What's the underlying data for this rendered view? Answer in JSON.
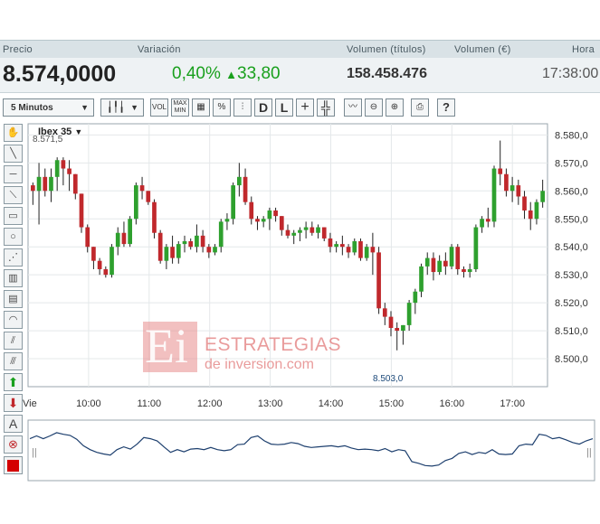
{
  "header": {
    "col_price": "Precio",
    "col_variation": "Variación",
    "col_volume_titles": "Volumen (títulos)",
    "col_volume_eur": "Volumen (€)",
    "col_time": "Hora"
  },
  "quote": {
    "price": "8.574,0000",
    "variation_pct": "0,40%",
    "variation_arrow": "▲",
    "variation_points": "33,80",
    "volume_titles": "158.458.476",
    "time": "17:38:00",
    "up_color": "#19a01d"
  },
  "toolbar": {
    "interval_select": "5 Minutos",
    "chart_type_icon": "candlestick-icon",
    "buttons": [
      "VOL",
      "MAX MIN",
      "grid",
      "%",
      "compare",
      "D",
      "L",
      "+",
      "crosshair",
      "indicator",
      "zoom-out",
      "zoom-in",
      "print",
      "?"
    ],
    "btn_vol": "VOL",
    "btn_maxmin_1": "MAX",
    "btn_maxmin_2": "MIN",
    "btn_pct": "%",
    "btn_d": "D",
    "btn_l": "L",
    "btn_help": "?"
  },
  "watermark": {
    "logo": "Ei",
    "line1": "ESTRATEGIAS",
    "line2": "de inversion.com"
  },
  "chart_data": {
    "type": "candlestick",
    "title": "Ibex 35",
    "title_arrow": "▼",
    "max_label": "8.571,5",
    "min_label": "8.503,0",
    "ylim": [
      8490,
      8584
    ],
    "y_ticks": [
      "8.580,0",
      "8.570,0",
      "8.560,0",
      "8.550,0",
      "8.540,0",
      "8.530,0",
      "8.520,0",
      "8.510,0",
      "8.500,0"
    ],
    "y_tick_values": [
      8580,
      8570,
      8560,
      8550,
      8540,
      8530,
      8520,
      8510,
      8500
    ],
    "x_ticks": [
      "Vie",
      "10:00",
      "11:00",
      "12:00",
      "13:00",
      "14:00",
      "15:00",
      "16:00",
      "17:00"
    ],
    "x_tick_hours": [
      9.0,
      10.0,
      11.0,
      12.0,
      13.0,
      14.0,
      15.0,
      16.0,
      17.0
    ],
    "x_range_hours": [
      9.0,
      17.58
    ],
    "up_color": "#2ea02e",
    "down_color": "#c0282c",
    "grid": true,
    "candles": [
      [
        8562,
        8563,
        8555,
        8560
      ],
      [
        8560,
        8570,
        8548,
        8565
      ],
      [
        8565,
        8568,
        8558,
        8560
      ],
      [
        8560,
        8568,
        8556,
        8565
      ],
      [
        8565,
        8572,
        8560,
        8571
      ],
      [
        8571,
        8572,
        8562,
        8568
      ],
      [
        8568,
        8571,
        8560,
        8566
      ],
      [
        8566,
        8566,
        8557,
        8559
      ],
      [
        8559,
        8559,
        8545,
        8547
      ],
      [
        8547,
        8548,
        8538,
        8540
      ],
      [
        8540,
        8540,
        8532,
        8535
      ],
      [
        8535,
        8536,
        8530,
        8532
      ],
      [
        8532,
        8533,
        8529,
        8530
      ],
      [
        8530,
        8541,
        8529,
        8540
      ],
      [
        8540,
        8547,
        8537,
        8545
      ],
      [
        8545,
        8549,
        8540,
        8541
      ],
      [
        8541,
        8551,
        8540,
        8550
      ],
      [
        8550,
        8563,
        8548,
        8562
      ],
      [
        8562,
        8565,
        8557,
        8560
      ],
      [
        8560,
        8560,
        8555,
        8556
      ],
      [
        8556,
        8557,
        8543,
        8545
      ],
      [
        8545,
        8546,
        8534,
        8535
      ],
      [
        8535,
        8541,
        8532,
        8540
      ],
      [
        8540,
        8544,
        8534,
        8536
      ],
      [
        8536,
        8542,
        8534,
        8541
      ],
      [
        8541,
        8544,
        8538,
        8542
      ],
      [
        8542,
        8543,
        8539,
        8540
      ],
      [
        8540,
        8548,
        8538,
        8544
      ],
      [
        8544,
        8546,
        8538,
        8540
      ],
      [
        8540,
        8541,
        8536,
        8538
      ],
      [
        8538,
        8541,
        8537,
        8540
      ],
      [
        8540,
        8550,
        8538,
        8549
      ],
      [
        8549,
        8552,
        8546,
        8550
      ],
      [
        8550,
        8563,
        8548,
        8562
      ],
      [
        8562,
        8570,
        8558,
        8565
      ],
      [
        8565,
        8568,
        8555,
        8556
      ],
      [
        8556,
        8558,
        8548,
        8550
      ],
      [
        8550,
        8551,
        8546,
        8549
      ],
      [
        8549,
        8551,
        8547,
        8550
      ],
      [
        8550,
        8554,
        8546,
        8553
      ],
      [
        8553,
        8554,
        8549,
        8551
      ],
      [
        8551,
        8551,
        8544,
        8546
      ],
      [
        8546,
        8548,
        8543,
        8544
      ],
      [
        8544,
        8546,
        8541,
        8545
      ],
      [
        8545,
        8547,
        8542,
        8546
      ],
      [
        8546,
        8549,
        8543,
        8547
      ],
      [
        8547,
        8549,
        8544,
        8545
      ],
      [
        8545,
        8548,
        8543,
        8547
      ],
      [
        8547,
        8547,
        8542,
        8543
      ],
      [
        8543,
        8545,
        8538,
        8540
      ],
      [
        8540,
        8542,
        8538,
        8541
      ],
      [
        8541,
        8544,
        8537,
        8540
      ],
      [
        8540,
        8541,
        8536,
        8538
      ],
      [
        8538,
        8543,
        8537,
        8542
      ],
      [
        8542,
        8543,
        8535,
        8536
      ],
      [
        8536,
        8541,
        8535,
        8540
      ],
      [
        8540,
        8545,
        8530,
        8538
      ],
      [
        8538,
        8540,
        8516,
        8518
      ],
      [
        8518,
        8520,
        8512,
        8515
      ],
      [
        8515,
        8517,
        8508,
        8511
      ],
      [
        8511,
        8513,
        8503,
        8510
      ],
      [
        8510,
        8512,
        8505,
        8512
      ],
      [
        8512,
        8521,
        8510,
        8520
      ],
      [
        8520,
        8525,
        8516,
        8524
      ],
      [
        8524,
        8534,
        8522,
        8533
      ],
      [
        8533,
        8538,
        8530,
        8536
      ],
      [
        8536,
        8538,
        8528,
        8531
      ],
      [
        8531,
        8537,
        8530,
        8535
      ],
      [
        8535,
        8538,
        8530,
        8533
      ],
      [
        8533,
        8541,
        8532,
        8540
      ],
      [
        8540,
        8541,
        8530,
        8532
      ],
      [
        8532,
        8533,
        8529,
        8531
      ],
      [
        8531,
        8534,
        8529,
        8532
      ],
      [
        8532,
        8548,
        8531,
        8547
      ],
      [
        8547,
        8551,
        8545,
        8550
      ],
      [
        8550,
        8554,
        8547,
        8549
      ],
      [
        8549,
        8569,
        8547,
        8568
      ],
      [
        8568,
        8578,
        8562,
        8566
      ],
      [
        8566,
        8568,
        8558,
        8560
      ],
      [
        8560,
        8565,
        8556,
        8562
      ],
      [
        8562,
        8564,
        8555,
        8558
      ],
      [
        8558,
        8560,
        8550,
        8553
      ],
      [
        8553,
        8556,
        8546,
        8550
      ],
      [
        8550,
        8557,
        8548,
        8556
      ],
      [
        8556,
        8564,
        8554,
        8560
      ]
    ],
    "mini_overview": "line"
  }
}
